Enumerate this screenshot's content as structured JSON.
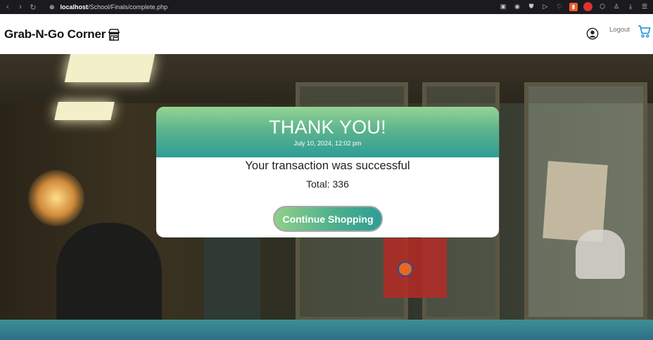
{
  "browser": {
    "url_host": "localhost",
    "url_path": "/School/Finals/complete.php"
  },
  "header": {
    "brand": "Grab-N-Go Corner",
    "logout_label": "Logout",
    "icons": [
      "store-icon",
      "user-icon",
      "cart-icon"
    ]
  },
  "confirmation": {
    "title": "THANK YOU!",
    "datetime": "July 10, 2024, 12:02 pm",
    "message": "Your transaction was successful",
    "total_label": "Total:",
    "total_value": "336",
    "button_label": "Continue Shopping"
  },
  "colors": {
    "header_gradient_top": "#96d493",
    "header_gradient_bottom": "#2f9d96",
    "button_gradient_start": "#92cf8a",
    "button_gradient_end": "#2f9d96",
    "cart_accent": "#1a8fd6",
    "footer": "#3c8f96"
  }
}
